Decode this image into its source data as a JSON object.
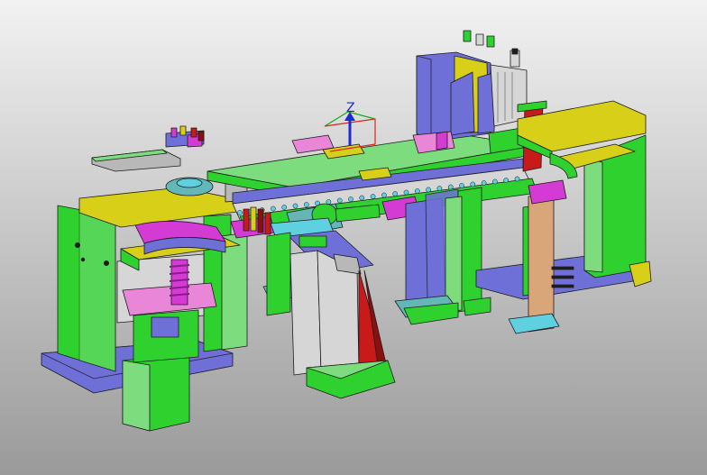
{
  "viewport": {
    "background_top": "#f2f2f2",
    "background_bottom": "#9a9a9a"
  },
  "triad": {
    "z_label": "Z",
    "z_color": "#1b2bd6",
    "x_color": "#e02020",
    "y_color": "#1aa51a"
  },
  "palette": {
    "green": "#2fd12f",
    "green_light": "#7ddc7d",
    "yellow": "#d8d018",
    "blue_purple": "#6f6fd8",
    "magenta": "#d43ad4",
    "pink": "#ea86d8",
    "red": "#c91a1a",
    "dark_red": "#8a1010",
    "cyan": "#5fd0e0",
    "teal": "#63b7b7",
    "tan": "#d9a67a",
    "grey": "#b8b8b8",
    "silver": "#d6d6d6",
    "outline": "#1c1c1c"
  }
}
